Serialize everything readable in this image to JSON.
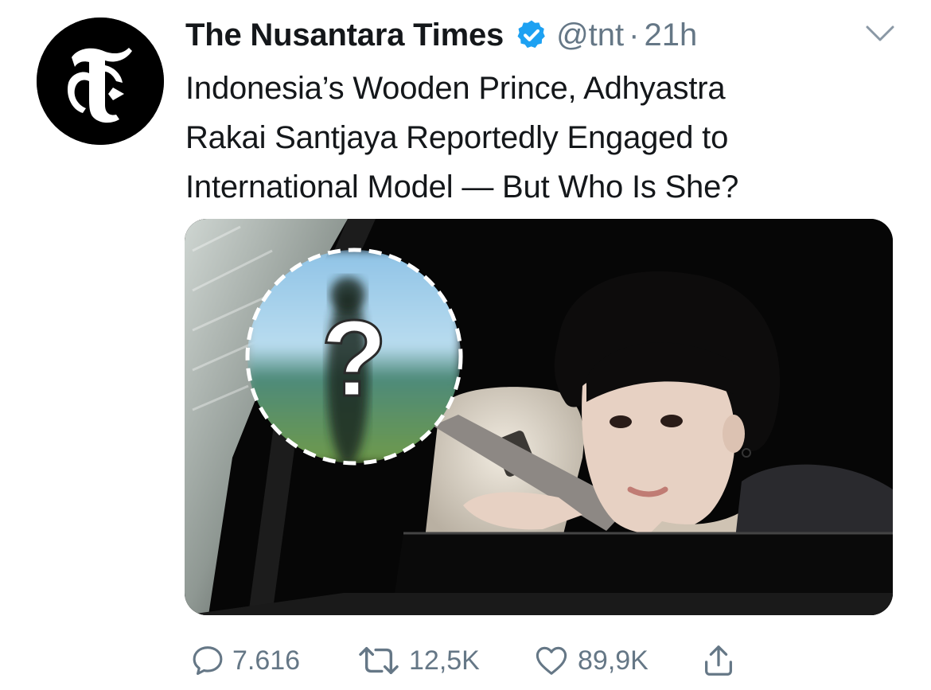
{
  "tweet": {
    "author_name": "The Nusantara Times",
    "verified": true,
    "handle": "@tnt",
    "separator": "·",
    "time": "21h",
    "text_lines": [
      "Indonesia’s Wooden Prince, Adhyastra",
      "Rakai Santjaya Reportedly Engaged to",
      "International Model — But Who Is She?"
    ],
    "media": {
      "mystery_mark": "?"
    }
  },
  "actions": {
    "replies": "7.616",
    "retweets": "12,5K",
    "likes": "89,9K"
  },
  "colors": {
    "text": "#14171a",
    "secondary": "#657786",
    "verified_blue": "#1da1f2",
    "avatar_bg": "#000000"
  },
  "icons": {
    "avatar": "blackletter-t-logo",
    "verified": "verified-badge-icon",
    "more": "chevron-down-icon",
    "reply": "reply-icon",
    "retweet": "retweet-icon",
    "like": "heart-icon",
    "share": "share-icon"
  }
}
